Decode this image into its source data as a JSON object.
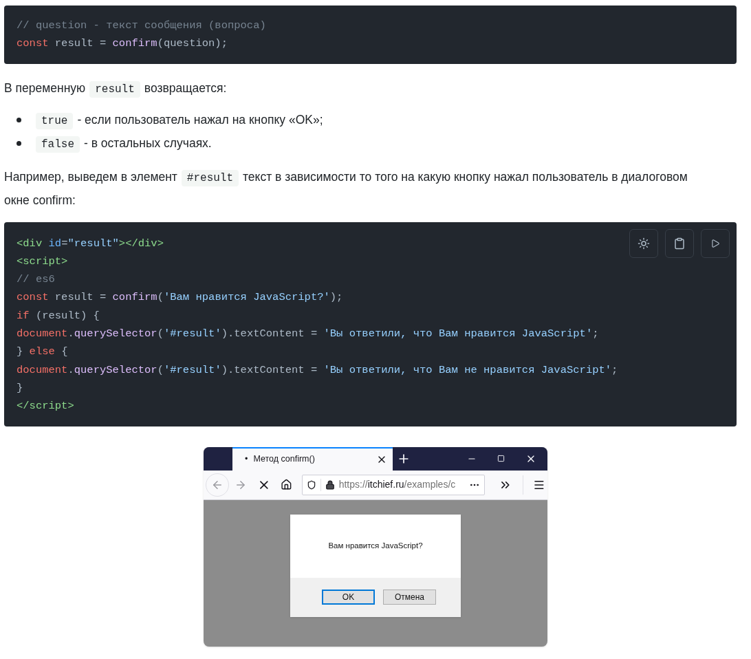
{
  "code_block_1": {
    "lines": [
      [
        {
          "kind": "comment",
          "text": "// question - текст сообщения (вопроса)"
        }
      ],
      [
        {
          "kind": "keyword",
          "text": "const"
        },
        {
          "kind": "plain",
          "text": " result = "
        },
        {
          "kind": "function",
          "text": "confirm"
        },
        {
          "kind": "plain",
          "text": "(question);"
        }
      ]
    ]
  },
  "paragraph_1": [
    {
      "kind": "text",
      "text": "В переменную"
    },
    {
      "kind": "code",
      "text": "result"
    },
    {
      "kind": "text",
      "text": "возвращается:"
    }
  ],
  "list": [
    [
      {
        "kind": "code",
        "text": "true"
      },
      {
        "kind": "text",
        "text": "- если пользователь нажал на кнопку «OK»;"
      }
    ],
    [
      {
        "kind": "code",
        "text": "false"
      },
      {
        "kind": "text",
        "text": "- в остальных случаях."
      }
    ]
  ],
  "paragraph_2": [
    {
      "kind": "text",
      "text": "Например, выведем в элемент"
    },
    {
      "kind": "code",
      "text": "#result"
    },
    {
      "kind": "text",
      "text": "текст в зависимости то того на какую кнопку нажал пользователь в диалоговом окне confirm:"
    }
  ],
  "code_block_2": {
    "lines": [
      [
        {
          "kind": "tag",
          "text": "<div "
        },
        {
          "kind": "attr",
          "text": "id"
        },
        {
          "kind": "plain",
          "text": "="
        },
        {
          "kind": "string",
          "text": "\"result\""
        },
        {
          "kind": "tag",
          "text": "></div>"
        }
      ],
      [
        {
          "kind": "tag",
          "text": "<script>"
        }
      ],
      [
        {
          "kind": "comment",
          "text": "// es6"
        }
      ],
      [
        {
          "kind": "keyword",
          "text": "const"
        },
        {
          "kind": "plain",
          "text": " result = "
        },
        {
          "kind": "function",
          "text": "confirm"
        },
        {
          "kind": "plain",
          "text": "("
        },
        {
          "kind": "string",
          "text": "'Вам нравится JavaScript?'"
        },
        {
          "kind": "plain",
          "text": ");"
        }
      ],
      [
        {
          "kind": "keyword",
          "text": "if"
        },
        {
          "kind": "plain",
          "text": " (result) {"
        }
      ],
      [
        {
          "kind": "keyword",
          "text": "document"
        },
        {
          "kind": "plain",
          "text": "."
        },
        {
          "kind": "function",
          "text": "querySelector"
        },
        {
          "kind": "plain",
          "text": "("
        },
        {
          "kind": "string",
          "text": "'#result'"
        },
        {
          "kind": "plain",
          "text": ").textContent = "
        },
        {
          "kind": "string",
          "text": "'Вы ответили, что Вам нравится JavaScript'"
        },
        {
          "kind": "plain",
          "text": ";"
        }
      ],
      [
        {
          "kind": "plain",
          "text": "} "
        },
        {
          "kind": "keyword",
          "text": "else"
        },
        {
          "kind": "plain",
          "text": " {"
        }
      ],
      [
        {
          "kind": "keyword",
          "text": "document"
        },
        {
          "kind": "plain",
          "text": "."
        },
        {
          "kind": "function",
          "text": "querySelector"
        },
        {
          "kind": "plain",
          "text": "("
        },
        {
          "kind": "string",
          "text": "'#result'"
        },
        {
          "kind": "plain",
          "text": ").textContent = "
        },
        {
          "kind": "string",
          "text": "'Вы ответили, что Вам не нравится JavaScript'"
        },
        {
          "kind": "plain",
          "text": ";"
        }
      ],
      [
        {
          "kind": "plain",
          "text": "}"
        }
      ],
      [
        {
          "kind": "tag",
          "text": "</script>"
        }
      ]
    ]
  },
  "browser_screenshot": {
    "tab": {
      "bullet": "•",
      "title": "Метод confirm()",
      "selected": true
    },
    "url": {
      "scheme": "https://",
      "host": "itchief.ru",
      "path": "/examples/c"
    },
    "dialog": {
      "message": "Вам нравится JavaScript?",
      "buttons": [
        {
          "label": "OK",
          "selected": true
        },
        {
          "label": "Отмена",
          "selected": false
        }
      ]
    }
  }
}
